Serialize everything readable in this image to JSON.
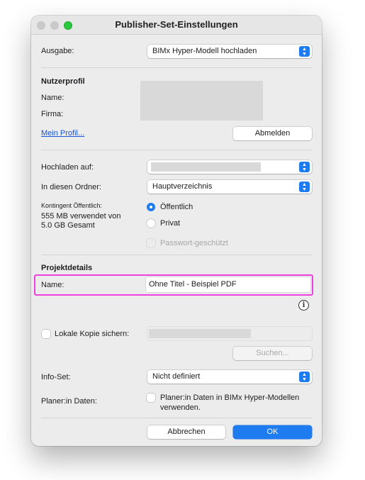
{
  "window": {
    "title": "Publisher-Set-Einstellungen"
  },
  "ausgabe": {
    "label": "Ausgabe:",
    "value": "BIMx Hyper-Modell hochladen"
  },
  "profile": {
    "heading": "Nutzerprofil",
    "name_label": "Name:",
    "firma_label": "Firma:",
    "link": "Mein Profil...",
    "logout_button": "Abmelden"
  },
  "upload": {
    "hochladen_label": "Hochladen auf:",
    "hochladen_value": "",
    "ordner_label": "In diesen Ordner:",
    "ordner_value": "Hauptverzeichnis",
    "quota_label": "Kontingent Öffentlich:",
    "quota_text_1": "555 MB verwendet von",
    "quota_text_2": "5.0 GB Gesamt",
    "radio_public": "Öffentlich",
    "radio_private": "Privat",
    "password_label": "Passwort-geschützt"
  },
  "project": {
    "heading": "Projektdetails",
    "name_label": "Name:",
    "name_value": "Ohne Titel - Beispiel PDF"
  },
  "local_copy": {
    "label": "Lokale Kopie sichern:",
    "search_button": "Suchen..."
  },
  "infoset": {
    "label": "Info-Set:",
    "value": "Nicht definiert"
  },
  "planer": {
    "label": "Planer:in Daten:",
    "checkbox_text_1": "Planer:in Daten in BIMx Hyper-Modellen",
    "checkbox_text_2": "verwenden."
  },
  "footer": {
    "cancel": "Abbrechen",
    "ok": "OK"
  },
  "colors": {
    "accent": "#1f7cf0",
    "highlight": "#ee3fe0"
  }
}
